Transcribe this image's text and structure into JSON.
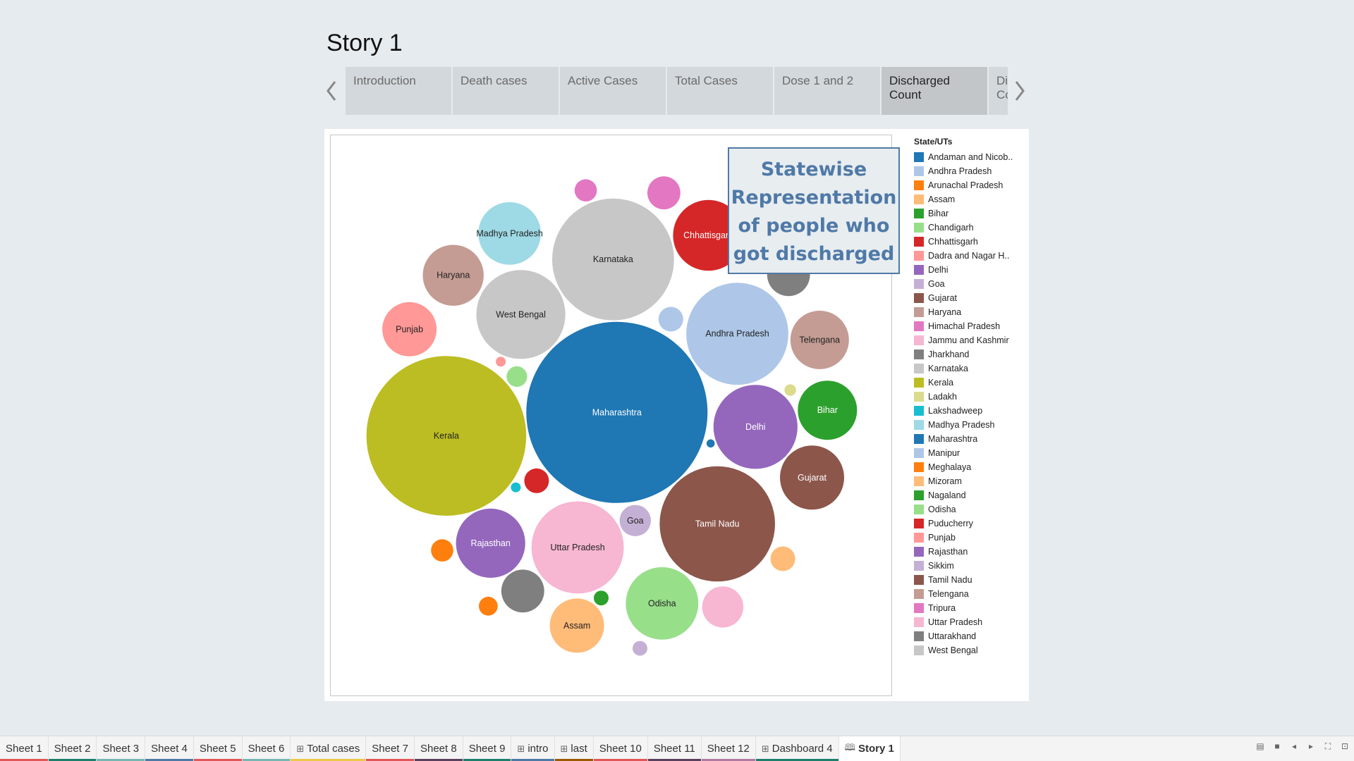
{
  "story": {
    "title": "Story 1"
  },
  "story_points": [
    {
      "label": "Introduction",
      "active": false
    },
    {
      "label": "Death cases",
      "active": false
    },
    {
      "label": "Active Cases",
      "active": false
    },
    {
      "label": "Total Cases",
      "active": false
    },
    {
      "label": "Dose 1 and 2",
      "active": false
    },
    {
      "label": "Discharged Count",
      "active": true
    },
    {
      "label": "Di Co",
      "active": false,
      "partial": true
    }
  ],
  "callout": {
    "text": "Statewise Representation of people who got discharged"
  },
  "legend": {
    "title": "State/UTs",
    "items": [
      {
        "label": "Andaman and Nicob..",
        "color": "#1f77b4"
      },
      {
        "label": "Andhra Pradesh",
        "color": "#aec7e8"
      },
      {
        "label": "Arunachal Pradesh",
        "color": "#ff7f0e"
      },
      {
        "label": "Assam",
        "color": "#ffbb78"
      },
      {
        "label": "Bihar",
        "color": "#2ca02c"
      },
      {
        "label": "Chandigarh",
        "color": "#98df8a"
      },
      {
        "label": "Chhattisgarh",
        "color": "#d62728"
      },
      {
        "label": "Dadra and Nagar H..",
        "color": "#ff9896"
      },
      {
        "label": "Delhi",
        "color": "#9467bd"
      },
      {
        "label": "Goa",
        "color": "#c5b0d5"
      },
      {
        "label": "Gujarat",
        "color": "#8c564b"
      },
      {
        "label": "Haryana",
        "color": "#c49c94"
      },
      {
        "label": "Himachal Pradesh",
        "color": "#e377c2"
      },
      {
        "label": "Jammu and Kashmir",
        "color": "#f7b6d2"
      },
      {
        "label": "Jharkhand",
        "color": "#7f7f7f"
      },
      {
        "label": "Karnataka",
        "color": "#c7c7c7"
      },
      {
        "label": "Kerala",
        "color": "#bcbd22"
      },
      {
        "label": "Ladakh",
        "color": "#dbdb8d"
      },
      {
        "label": "Lakshadweep",
        "color": "#17becf"
      },
      {
        "label": "Madhya Pradesh",
        "color": "#9edae5"
      },
      {
        "label": "Maharashtra",
        "color": "#1f77b4"
      },
      {
        "label": "Manipur",
        "color": "#aec7e8"
      },
      {
        "label": "Meghalaya",
        "color": "#ff7f0e"
      },
      {
        "label": "Mizoram",
        "color": "#ffbb78"
      },
      {
        "label": "Nagaland",
        "color": "#2ca02c"
      },
      {
        "label": "Odisha",
        "color": "#98df8a"
      },
      {
        "label": "Puducherry",
        "color": "#d62728"
      },
      {
        "label": "Punjab",
        "color": "#ff9896"
      },
      {
        "label": "Rajasthan",
        "color": "#9467bd"
      },
      {
        "label": "Sikkim",
        "color": "#c5b0d5"
      },
      {
        "label": "Tamil Nadu",
        "color": "#8c564b"
      },
      {
        "label": "Telengana",
        "color": "#c49c94"
      },
      {
        "label": "Tripura",
        "color": "#e377c2"
      },
      {
        "label": "Uttar Pradesh",
        "color": "#f7b6d2"
      },
      {
        "label": "Uttarakhand",
        "color": "#7f7f7f"
      },
      {
        "label": "West Bengal",
        "color": "#c7c7c7"
      }
    ]
  },
  "sheet_tabs": [
    {
      "label": "Sheet 1",
      "color": "#e15759",
      "icon": ""
    },
    {
      "label": "Sheet 2",
      "color": "#1b7f6b",
      "icon": ""
    },
    {
      "label": "Sheet 3",
      "color": "#76b7b2",
      "icon": ""
    },
    {
      "label": "Sheet 4",
      "color": "#4e79a7",
      "icon": ""
    },
    {
      "label": "Sheet 5",
      "color": "#e15759",
      "icon": ""
    },
    {
      "label": "Sheet 6",
      "color": "#76b7b2",
      "icon": ""
    },
    {
      "label": "Total cases",
      "color": "#edc948",
      "icon": "dashboard-icon"
    },
    {
      "label": "Sheet 7",
      "color": "#e15759",
      "icon": ""
    },
    {
      "label": "Sheet 8",
      "color": "#59405c",
      "icon": ""
    },
    {
      "label": "Sheet 9",
      "color": "#1b7f6b",
      "icon": ""
    },
    {
      "label": "intro",
      "color": "#4e79a7",
      "icon": "dashboard-icon"
    },
    {
      "label": "last",
      "color": "#9c5a00",
      "icon": "dashboard-icon"
    },
    {
      "label": "Sheet 10",
      "color": "#e15759",
      "icon": ""
    },
    {
      "label": "Sheet 11",
      "color": "#59405c",
      "icon": ""
    },
    {
      "label": "Sheet 12",
      "color": "#b07aa1",
      "icon": ""
    },
    {
      "label": "Dashboard 4",
      "color": "#1b7f6b",
      "icon": "dashboard-icon"
    },
    {
      "label": "Story 1",
      "color": "",
      "icon": "story-icon",
      "active": true
    }
  ],
  "chart_data": {
    "type": "packed-bubble",
    "title": "Statewise Representation of people who got discharged",
    "legend_title": "State/UTs",
    "legend_position": "right",
    "bubbles": [
      {
        "name": "Maharashtra",
        "size": 48400,
        "color": "#1f77b4",
        "label": "Maharashtra",
        "text": "#fff"
      },
      {
        "name": "Kerala",
        "size": 37636,
        "color": "#bcbd22",
        "label": "Kerala",
        "text": "#222"
      },
      {
        "name": "Karnataka",
        "size": 21904,
        "color": "#c7c7c7",
        "label": "Karnataka",
        "text": "#222"
      },
      {
        "name": "Tamil Nadu",
        "size": 19600,
        "color": "#8c564b",
        "label": "Tamil Nadu",
        "text": "#fff"
      },
      {
        "name": "Andhra Pradesh",
        "size": 15376,
        "color": "#aec7e8",
        "label": "Andhra Pradesh",
        "text": "#222"
      },
      {
        "name": "Uttar Pradesh",
        "size": 12544,
        "color": "#f7b6d2",
        "label": "Uttar Pradesh",
        "text": "#222"
      },
      {
        "name": "West Bengal",
        "size": 11664,
        "color": "#c7c7c7",
        "label": "West Bengal",
        "text": "#222"
      },
      {
        "name": "Delhi",
        "size": 10404,
        "color": "#9467bd",
        "label": "Delhi",
        "text": "#fff"
      },
      {
        "name": "Odisha",
        "size": 7744,
        "color": "#98df8a",
        "label": "Odisha",
        "text": "#222"
      },
      {
        "name": "Chhattisgarh",
        "size": 7396,
        "color": "#d62728",
        "label": "Chhattisgarh",
        "text": "#fff"
      },
      {
        "name": "Rajasthan",
        "size": 7056,
        "color": "#9467bd",
        "label": "Rajasthan",
        "text": "#fff"
      },
      {
        "name": "Bihar",
        "size": 5184,
        "color": "#2ca02c",
        "label": "Bihar",
        "text": "#fff"
      },
      {
        "name": "Madhya Pradesh",
        "size": 5776,
        "color": "#9edae5",
        "label": "Madhya Pradesh",
        "text": "#222"
      },
      {
        "name": "Gujarat",
        "size": 6084,
        "color": "#8c564b",
        "label": "Gujarat",
        "text": "#fff"
      },
      {
        "name": "Haryana",
        "size": 5476,
        "color": "#c49c94",
        "label": "Haryana",
        "text": "#222"
      },
      {
        "name": "Telengana",
        "size": 5041,
        "color": "#c49c94",
        "label": "Telengana",
        "text": "#222"
      },
      {
        "name": "Assam",
        "size": 4356,
        "color": "#ffbb78",
        "label": "Assam",
        "text": "#222"
      },
      {
        "name": "Punjab",
        "size": 4356,
        "color": "#ff9896",
        "label": "Punjab",
        "text": "#222"
      },
      {
        "name": "Jharkhand",
        "size": 2704,
        "color": "#7f7f7f",
        "label": "",
        "text": "#222"
      },
      {
        "name": "Uttarakhand",
        "size": 2704,
        "color": "#7f7f7f",
        "label": "",
        "text": "#222"
      },
      {
        "name": "Jammu and Kashmir",
        "size": 2500,
        "color": "#f7b6d2",
        "label": "",
        "text": "#222"
      },
      {
        "name": "Himachal Pradesh",
        "size": 1600,
        "color": "#e377c2",
        "label": "",
        "text": "#222"
      },
      {
        "name": "Goa",
        "size": 1444,
        "color": "#c5b0d5",
        "label": "Goa",
        "text": "#222"
      },
      {
        "name": "Puducherry",
        "size": 900,
        "color": "#d62728",
        "label": "",
        "text": "#222"
      },
      {
        "name": "Manipur",
        "size": 900,
        "color": "#aec7e8",
        "label": "",
        "text": "#222"
      },
      {
        "name": "Mizoram",
        "size": 900,
        "color": "#ffbb78",
        "label": "",
        "text": "#222"
      },
      {
        "name": "Meghalaya",
        "size": 729,
        "color": "#ff7f0e",
        "label": "",
        "text": "#222"
      },
      {
        "name": "Tripura",
        "size": 729,
        "color": "#e377c2",
        "label": "",
        "text": "#222"
      },
      {
        "name": "Chandigarh",
        "size": 625,
        "color": "#98df8a",
        "label": "",
        "text": "#222"
      },
      {
        "name": "Arunachal Pradesh",
        "size": 529,
        "color": "#ff7f0e",
        "label": "",
        "text": "#222"
      },
      {
        "name": "Nagaland",
        "size": 324,
        "color": "#2ca02c",
        "label": "",
        "text": "#222"
      },
      {
        "name": "Sikkim",
        "size": 324,
        "color": "#c5b0d5",
        "label": "",
        "text": "#222"
      },
      {
        "name": "Ladakh",
        "size": 196,
        "color": "#dbdb8d",
        "label": "",
        "text": "#222"
      },
      {
        "name": "Lakshadweep",
        "size": 144,
        "color": "#17becf",
        "label": "",
        "text": "#222"
      },
      {
        "name": "Dadra and Nagar H..",
        "size": 144,
        "color": "#ff9896",
        "label": "",
        "text": "#222"
      },
      {
        "name": "Andaman and Nicob..",
        "size": 100,
        "color": "#1f77b4",
        "label": "",
        "text": "#222"
      }
    ]
  }
}
